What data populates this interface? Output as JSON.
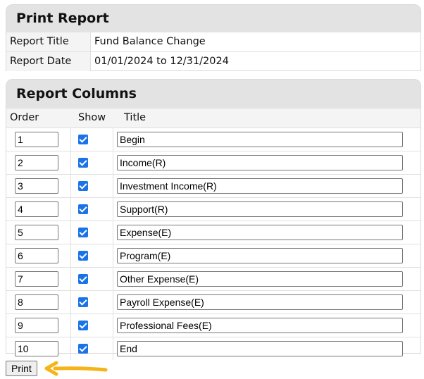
{
  "print_report": {
    "heading": "Print Report",
    "fields": [
      {
        "label": "Report Title",
        "value": "Fund Balance Change"
      },
      {
        "label": "Report Date",
        "value": "01/01/2024 to 12/31/2024"
      }
    ]
  },
  "report_columns": {
    "heading": "Report Columns",
    "headers": {
      "order": "Order",
      "show": "Show",
      "title": "Title"
    },
    "rows": [
      {
        "order": "1",
        "show": true,
        "title": "Begin"
      },
      {
        "order": "2",
        "show": true,
        "title": "Income(R)"
      },
      {
        "order": "3",
        "show": true,
        "title": "Investment Income(R)"
      },
      {
        "order": "4",
        "show": true,
        "title": "Support(R)"
      },
      {
        "order": "5",
        "show": true,
        "title": "Expense(E)"
      },
      {
        "order": "6",
        "show": true,
        "title": "Program(E)"
      },
      {
        "order": "7",
        "show": true,
        "title": "Other Expense(E)"
      },
      {
        "order": "8",
        "show": true,
        "title": "Payroll Expense(E)"
      },
      {
        "order": "9",
        "show": true,
        "title": "Professional Fees(E)"
      },
      {
        "order": "10",
        "show": true,
        "title": "End"
      }
    ]
  },
  "actions": {
    "print_label": "Print"
  },
  "colors": {
    "checkbox": "#1a73e8",
    "arrow": "#f5b417",
    "header_bg": "#e3e3e3"
  },
  "annotation": {
    "icon": "arrow-left-icon"
  }
}
